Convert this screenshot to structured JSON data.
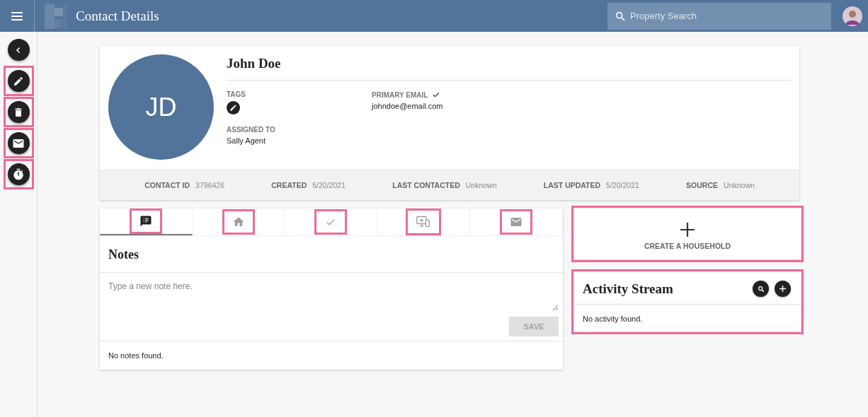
{
  "topbar": {
    "title": "Contact Details",
    "search": {
      "placeholder": "Property Search"
    }
  },
  "rail": [
    {
      "kind": "back",
      "highlighted": false
    },
    {
      "kind": "edit",
      "highlighted": true
    },
    {
      "kind": "delete",
      "highlighted": true
    },
    {
      "kind": "email",
      "highlighted": true
    },
    {
      "kind": "timer",
      "highlighted": true
    }
  ],
  "contact": {
    "initials": "JD",
    "name": "John Doe",
    "fields": [
      {
        "kind": "tags",
        "label": "TAGS"
      },
      {
        "kind": "email",
        "label": "PRIMARY EMAIL",
        "verified": true,
        "value": "johndoe@email.com"
      },
      {
        "kind": "text",
        "label": "ASSIGNED TO",
        "value": "Sally Agent"
      }
    ],
    "stats": [
      {
        "label": "CONTACT ID",
        "value": "3796426"
      },
      {
        "label": "CREATED",
        "value": "5/20/2021"
      },
      {
        "label": "LAST CONTACTED",
        "value": "Unknown"
      },
      {
        "label": "LAST UPDATED",
        "value": "5/20/2021"
      },
      {
        "label": "SOURCE",
        "value": "Unknown"
      }
    ]
  },
  "tabs": [
    {
      "kind": "notes",
      "selected": true,
      "highlighted": true
    },
    {
      "kind": "home",
      "selected": false,
      "highlighted": true
    },
    {
      "kind": "tasks",
      "selected": false,
      "highlighted": true
    },
    {
      "kind": "devices",
      "selected": false,
      "highlighted": true
    },
    {
      "kind": "email",
      "selected": false,
      "highlighted": true
    }
  ],
  "notes": {
    "title": "Notes",
    "placeholder": "Type a new note here.",
    "save": {
      "label": "SAVE",
      "disabled": true
    },
    "empty": "No notes found."
  },
  "household": {
    "label": "CREATE A HOUSEHOLD",
    "highlighted": true
  },
  "activity": {
    "title": "Activity Stream",
    "empty": "No activity found.",
    "highlighted": true
  }
}
